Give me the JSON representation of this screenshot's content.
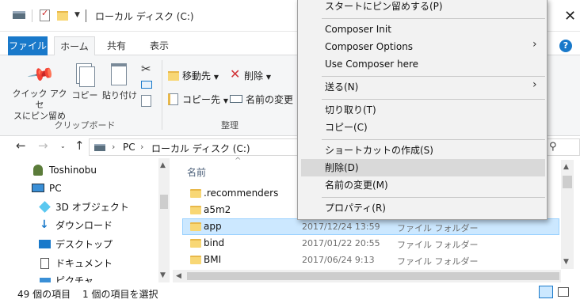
{
  "window": {
    "title": "ローカル ディスク (C:)"
  },
  "ribbon_tabs": [
    "ファイル",
    "ホーム",
    "共有",
    "表示"
  ],
  "ribbon": {
    "pin_quick_access_1": "クイック アクセ",
    "pin_quick_access_2": "スにピン留め",
    "copy": "コピー",
    "paste": "貼り付け",
    "clipboard_group": "クリップボード",
    "move_to": "移動先",
    "copy_to": "コピー先",
    "delete": "削除",
    "rename": "名前の変更",
    "organize_group": "整理"
  },
  "address": {
    "crumbs": [
      "PC",
      "ローカル ディスク (C:)"
    ]
  },
  "nav_pane": [
    {
      "label": "Toshinobu",
      "icon": "user-icon"
    },
    {
      "label": "PC",
      "icon": "computer-icon"
    },
    {
      "label": "3D オブジェクト",
      "icon": "cube-icon"
    },
    {
      "label": "ダウンロード",
      "icon": "download-icon"
    },
    {
      "label": "デスクトップ",
      "icon": "desktop-icon"
    },
    {
      "label": "ドキュメント",
      "icon": "document-icon"
    },
    {
      "label": "ピクチャ",
      "icon": "picture-icon"
    }
  ],
  "file_list": {
    "column_name": "名前",
    "rows": [
      {
        "name": ".recommenders",
        "date": "",
        "type": ""
      },
      {
        "name": "a5m2",
        "date": "",
        "type": ""
      },
      {
        "name": "app",
        "date": "2017/12/24 13:59",
        "type": "ファイル フォルダー"
      },
      {
        "name": "bind",
        "date": "2017/01/22 20:55",
        "type": "ファイル フォルダー"
      },
      {
        "name": "BMI",
        "date": "2017/06/24 9:13",
        "type": "ファイル フォルダー"
      }
    ]
  },
  "status": {
    "count": "49 個の項目",
    "selected": "1 個の項目を選択"
  },
  "context_menu": {
    "pin_start": "スタートにピン留めする(P)",
    "composer_init": "Composer Init",
    "composer_options": "Composer Options",
    "use_composer": "Use Composer here",
    "send_to": "送る(N)",
    "cut": "切り取り(T)",
    "copy": "コピー(C)",
    "create_shortcut": "ショートカットの作成(S)",
    "delete": "削除(D)",
    "rename": "名前の変更(M)",
    "properties": "プロパティ(R)"
  },
  "colors": {
    "accent": "#1979ca",
    "selection": "#cce8ff",
    "folder": "#f8d775"
  }
}
